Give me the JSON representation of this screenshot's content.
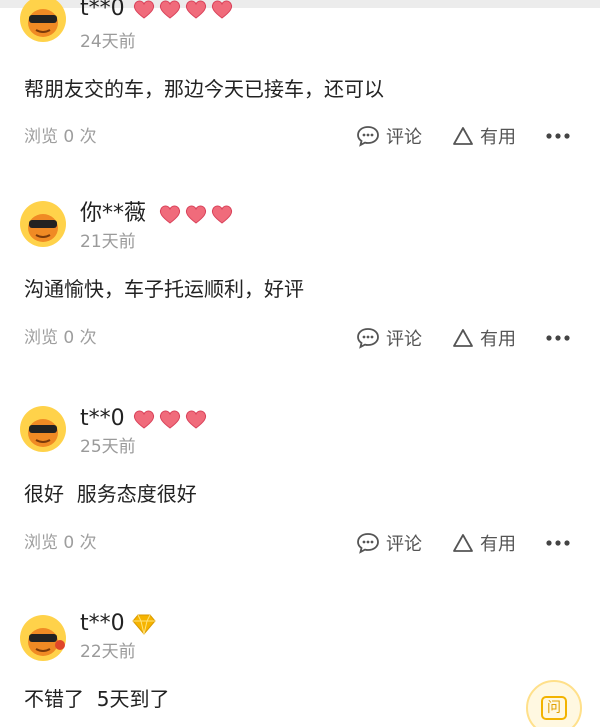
{
  "reviews": [
    {
      "nickname": "t**0",
      "time": "24天前",
      "content": "帮朋友交的车，那边今天已接车，还可以",
      "views": "浏览 0 次",
      "comment_label": "评论",
      "useful_label": "有用",
      "badge": "hearts"
    },
    {
      "nickname": "你**薇",
      "time": "21天前",
      "content": "沟通愉快，车子托运顺利，好评",
      "views": "浏览 0 次",
      "comment_label": "评论",
      "useful_label": "有用",
      "badge": "hearts"
    },
    {
      "nickname": "t**0",
      "time": "25天前",
      "content": "很好  服务态度很好",
      "views": "浏览 0 次",
      "comment_label": "评论",
      "useful_label": "有用",
      "badge": "hearts"
    },
    {
      "nickname": "t**0",
      "time": "22天前",
      "content": "不错了  5天到了",
      "badge": "diamond"
    }
  ],
  "fab": {
    "label": "问",
    "icon": "question-bubble-icon"
  },
  "colors": {
    "heart": "#f06b7b",
    "diamond": "#f6b400",
    "avatar_bg": "#ffd24a",
    "avatar_body": "#f08a24"
  }
}
